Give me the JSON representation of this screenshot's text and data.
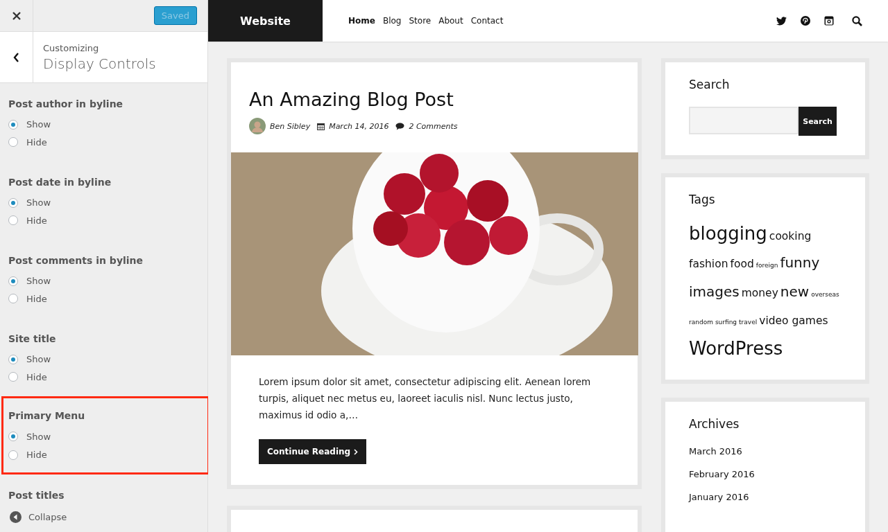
{
  "panel": {
    "save_button": {
      "label": "Saved",
      "disabled": true
    },
    "header": {
      "eyebrow": "Customizing",
      "title": "Display Controls"
    },
    "groups": [
      {
        "title": "Post author in byline",
        "highlighted": false,
        "options": [
          {
            "label": "Show",
            "selected": true
          },
          {
            "label": "Hide",
            "selected": false
          }
        ]
      },
      {
        "title": "Post date in byline",
        "highlighted": false,
        "options": [
          {
            "label": "Show",
            "selected": true
          },
          {
            "label": "Hide",
            "selected": false
          }
        ]
      },
      {
        "title": "Post comments in byline",
        "highlighted": false,
        "options": [
          {
            "label": "Show",
            "selected": true
          },
          {
            "label": "Hide",
            "selected": false
          }
        ]
      },
      {
        "title": "Site title",
        "highlighted": false,
        "options": [
          {
            "label": "Show",
            "selected": true
          },
          {
            "label": "Hide",
            "selected": false
          }
        ]
      },
      {
        "title": "Primary Menu",
        "highlighted": true,
        "options": [
          {
            "label": "Show",
            "selected": true
          },
          {
            "label": "Hide",
            "selected": false
          }
        ]
      },
      {
        "title": "Post titles",
        "highlighted": false
      }
    ],
    "collapse": {
      "label": "Collapse"
    }
  },
  "site": {
    "title": "Website",
    "menu": [
      {
        "label": "Home",
        "selected": true
      },
      {
        "label": "Blog",
        "selected": false
      },
      {
        "label": "Store",
        "selected": false
      },
      {
        "label": "About",
        "selected": false
      },
      {
        "label": "Contact",
        "selected": false
      }
    ],
    "social": [
      {
        "kind": "twitter"
      },
      {
        "kind": "pinterest"
      },
      {
        "kind": "instagram"
      },
      {
        "kind": "search"
      }
    ]
  },
  "post": {
    "title": "An Amazing Blog Post",
    "author": "Ben Sibley",
    "date": "March 14, 2016",
    "comments": "2 Comments",
    "excerpt": "Lorem ipsum dolor sit amet, consectetur adipiscing elit. Aenean lorem turpis, aliquet nec metus eu, laoreet iaculis nisl. Nunc lectus justo, maximus id odio a,…",
    "button": "Continue Reading"
  },
  "widgets": {
    "search": {
      "title": "Search",
      "button": "Search"
    },
    "tags": {
      "title": "Tags",
      "items": [
        {
          "label": "blogging",
          "kind": "xl"
        },
        {
          "label": "cooking",
          "kind": "m"
        },
        {
          "label": "fashion",
          "kind": "m"
        },
        {
          "label": "food",
          "kind": "m"
        },
        {
          "label": "foreign",
          "kind": "xs"
        },
        {
          "label": "funny",
          "kind": "l"
        },
        {
          "label": "images",
          "kind": "l"
        },
        {
          "label": "money",
          "kind": "m"
        },
        {
          "label": "new",
          "kind": "l"
        },
        {
          "label": "overseas",
          "kind": "xs"
        },
        {
          "label": "random",
          "kind": "xs"
        },
        {
          "label": "surfing",
          "kind": "xs"
        },
        {
          "label": "travel",
          "kind": "xs"
        },
        {
          "label": "video games",
          "kind": "m"
        },
        {
          "label": "WordPress",
          "kind": "xl"
        }
      ]
    },
    "archives": {
      "title": "Archives",
      "items": [
        "March 2016",
        "February 2016",
        "January 2016"
      ]
    }
  }
}
